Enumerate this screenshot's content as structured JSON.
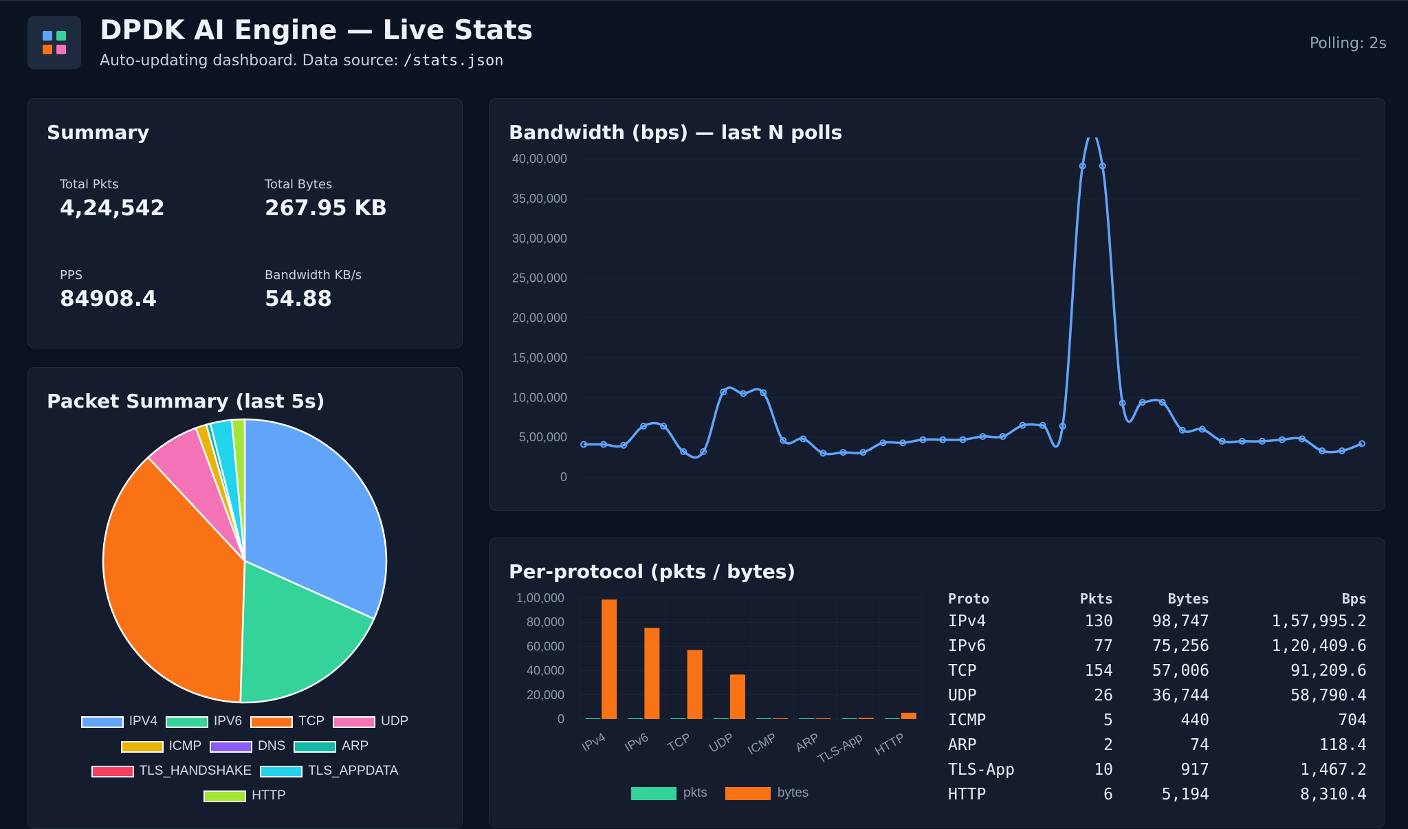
{
  "header": {
    "title": "DPDK AI Engine — Live Stats",
    "subtitle_prefix": "Auto-updating dashboard. Data source:",
    "subtitle_source": "/stats.json",
    "polling": "Polling: 2s",
    "logo_colors": [
      "#60a5fa",
      "#34d399",
      "#f97316",
      "#f472b6"
    ]
  },
  "summary": {
    "title": "Summary",
    "stats": [
      {
        "label": "Total Pkts",
        "value": "4,24,542"
      },
      {
        "label": "Total Bytes",
        "value": "267.95 KB"
      },
      {
        "label": "PPS",
        "value": "84908.4"
      },
      {
        "label": "Bandwidth KB/s",
        "value": "54.88"
      }
    ]
  },
  "packet_summary": {
    "title": "Packet Summary (last 5s)"
  },
  "bandwidth": {
    "title": "Bandwidth (bps) — last N polls"
  },
  "per_protocol": {
    "title": "Per-protocol (pkts / bytes)",
    "table_headers": [
      "Proto",
      "Pkts",
      "Bytes",
      "Bps"
    ],
    "table_rows": [
      [
        "IPv4",
        "130",
        "98,747",
        "1,57,995.2"
      ],
      [
        "IPv6",
        "77",
        "75,256",
        "1,20,409.6"
      ],
      [
        "TCP",
        "154",
        "57,006",
        "91,209.6"
      ],
      [
        "UDP",
        "26",
        "36,744",
        "58,790.4"
      ],
      [
        "ICMP",
        "5",
        "440",
        "704"
      ],
      [
        "ARP",
        "2",
        "74",
        "118.4"
      ],
      [
        "TLS-App",
        "10",
        "917",
        "1,467.2"
      ],
      [
        "HTTP",
        "6",
        "5,194",
        "8,310.4"
      ]
    ]
  },
  "chart_data": [
    {
      "type": "pie",
      "title": "Packet Summary (last 5s)",
      "legend_position": "bottom",
      "labels": [
        "IPV4",
        "IPV6",
        "TCP",
        "UDP",
        "ICMP",
        "DNS",
        "ARP",
        "TLS_HANDSHAKE",
        "TLS_APPDATA",
        "HTTP"
      ],
      "values": [
        130,
        77,
        154,
        26,
        5,
        0,
        2,
        0,
        10,
        6
      ],
      "colors": [
        "#60a5fa",
        "#34d399",
        "#f97316",
        "#f472b6",
        "#eab308",
        "#8b5cf6",
        "#14b8a6",
        "#f43f5e",
        "#22d3ee",
        "#a3e635"
      ]
    },
    {
      "type": "line",
      "title": "Bandwidth (bps) — last N polls",
      "ylim": [
        0,
        4000000
      ],
      "yticks": [
        0,
        500000,
        1000000,
        1500000,
        2000000,
        2500000,
        3000000,
        3500000,
        4000000
      ],
      "ytick_labels": [
        "0",
        "5,00,000",
        "10,00,000",
        "15,00,000",
        "20,00,000",
        "25,00,000",
        "30,00,000",
        "35,00,000",
        "40,00,000"
      ],
      "grid": true,
      "color": "#60a5fa",
      "series": [
        {
          "values": [
            410000,
            410000,
            400000,
            640000,
            640000,
            320000,
            320000,
            1070000,
            1050000,
            1060000,
            460000,
            480000,
            300000,
            310000,
            310000,
            430000,
            430000,
            470000,
            470000,
            470000,
            510000,
            510000,
            650000,
            650000,
            640000,
            3910000,
            3910000,
            930000,
            940000,
            940000,
            590000,
            600000,
            450000,
            450000,
            450000,
            470000,
            480000,
            330000,
            330000,
            420000
          ]
        }
      ]
    },
    {
      "type": "bar",
      "title": "Per-protocol (pkts / bytes)",
      "categories": [
        "IPv4",
        "IPv6",
        "TCP",
        "UDP",
        "ICMP",
        "ARP",
        "TLS-App",
        "HTTP"
      ],
      "ylim": [
        0,
        100000
      ],
      "yticks": [
        0,
        20000,
        40000,
        60000,
        80000,
        100000
      ],
      "ytick_labels": [
        "0",
        "20,000",
        "40,000",
        "60,000",
        "80,000",
        "1,00,000"
      ],
      "legend_position": "bottom",
      "series": [
        {
          "name": "pkts",
          "color": "#34d399",
          "values": [
            130,
            77,
            154,
            26,
            5,
            2,
            10,
            6
          ]
        },
        {
          "name": "bytes",
          "color": "#f97316",
          "values": [
            98747,
            75256,
            57006,
            36744,
            440,
            74,
            917,
            5194
          ]
        }
      ]
    }
  ]
}
